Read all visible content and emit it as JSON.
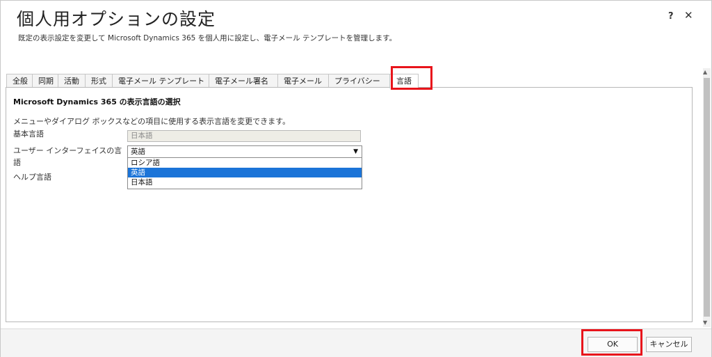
{
  "dialog": {
    "title": "個人用オプションの設定",
    "subtitle": "既定の表示設定を変更して Microsoft Dynamics 365 を個人用に設定し、電子メール テンプレートを管理します。",
    "help_label": "?",
    "close_label": "✕"
  },
  "tabs": [
    {
      "label": "全般"
    },
    {
      "label": "同期"
    },
    {
      "label": "活動"
    },
    {
      "label": "形式"
    },
    {
      "label": "電子メール テンプレート"
    },
    {
      "label": "電子メール署名"
    },
    {
      "label": "電子メール"
    },
    {
      "label": "プライバシー"
    },
    {
      "label": "言語",
      "active": true
    }
  ],
  "language_section": {
    "title": "Microsoft Dynamics 365 の表示言語の選択",
    "description": "メニューやダイアログ ボックスなどの項目に使用する表示言語を変更できます。",
    "base_language_label": "基本言語",
    "base_language_value": "日本語",
    "ui_language_label_line1": "ユーザー インターフェイスの言",
    "ui_language_label_line2": "語",
    "ui_language_value": "英語",
    "ui_language_options": [
      "ロシア語",
      "英語",
      "日本語"
    ],
    "help_language_label": "ヘルプ言語"
  },
  "footer": {
    "ok_label": "OK",
    "cancel_label": "キャンセル"
  },
  "colors": {
    "highlight": "#e8141b",
    "selected_option": "#1b74d8"
  }
}
